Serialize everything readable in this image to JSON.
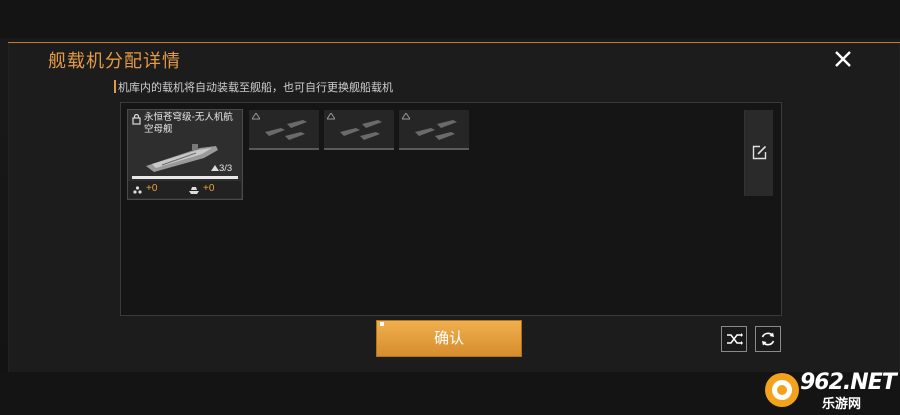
{
  "panel": {
    "title": "舰载机分配详情",
    "hint": "机库内的载机将自动装载至舰船，也可自行更换舰船载机"
  },
  "ship": {
    "name": "永恒苍穹级-无人机航空母舰",
    "capacity": "3/3",
    "stat_a": "+0",
    "stat_b": "+0"
  },
  "slots": [
    {
      "icon": "aircraft-group-icon"
    },
    {
      "icon": "aircraft-group-icon"
    },
    {
      "icon": "aircraft-group-icon"
    }
  ],
  "actions": {
    "confirm_label": "确认",
    "shuffle_icon": "shuffle-icon",
    "refresh_icon": "refresh-icon",
    "edit_icon": "edit-icon",
    "close_icon": "close-icon"
  },
  "watermark": {
    "main": "962.NET",
    "sub": "乐游网"
  },
  "colors": {
    "accent": "#e39a45",
    "button": "#e8a543",
    "stat": "#e9a23a"
  }
}
